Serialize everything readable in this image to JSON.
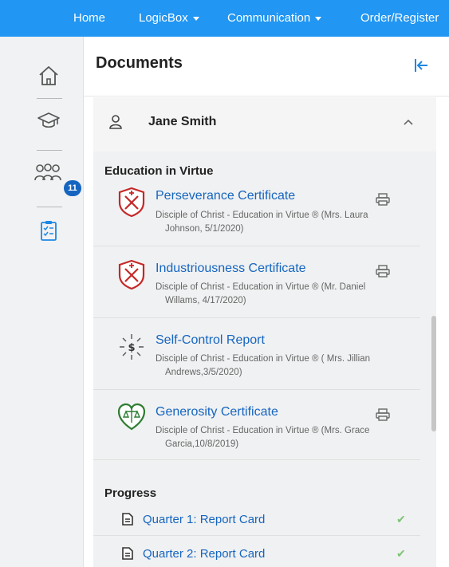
{
  "nav": {
    "items": [
      {
        "label": "Home",
        "has_caret": false
      },
      {
        "label": "LogicBox",
        "has_caret": true
      },
      {
        "label": "Communication",
        "has_caret": true
      },
      {
        "label": "Order/Register",
        "has_caret": false
      }
    ]
  },
  "sidebar": {
    "icons": [
      "home-icon",
      "graduation-cap-icon",
      "people-group-icon",
      "clipboard-checklist-icon"
    ],
    "people_badge": "11"
  },
  "header": {
    "title": "Documents",
    "collapse_icon": "collapse-left-icon"
  },
  "student": {
    "name": "Jane Smith",
    "expand_icon": "chevron-up-icon"
  },
  "education": {
    "section_title": "Education in Virtue",
    "documents": [
      {
        "title": "Perseverance Certificate",
        "meta_line1": "Disciple of Christ - Education in Virtue ® (Mrs. Laura",
        "meta_line2": "Johnson, 5/1/2020)",
        "icon": "shield-crossed-swords-icon",
        "printable": true
      },
      {
        "title": "Industriousness Certificate",
        "meta_line1": "Disciple of Christ - Education in Virtue ® (Mr. Daniel",
        "meta_line2": "Willams,  4/17/2020)",
        "icon": "shield-crossed-swords-icon",
        "printable": true
      },
      {
        "title": "Self-Control Report",
        "meta_line1": "Disciple of Christ - Education in Virtue ® ( Mrs. Jillian",
        "meta_line2": "Andrews,3/5/2020)",
        "icon": "radiant-dollar-icon",
        "printable": false
      },
      {
        "title": "Generosity Certificate",
        "meta_line1": "Disciple of Christ - Education in Virtue ® (Mrs. Grace",
        "meta_line2": "Garcia,10/8/2019)",
        "icon": "heart-scales-icon",
        "printable": true
      }
    ]
  },
  "progress": {
    "section_title": "Progress",
    "items": [
      {
        "label": "Quarter 1: Report Card",
        "status": "complete"
      },
      {
        "label": "Quarter 2: Report Card",
        "status": "complete"
      }
    ]
  },
  "colors": {
    "nav_bg": "#2196f3",
    "link": "#1565c0",
    "shield_red": "#c62828",
    "heart_green": "#2e7d32",
    "check_green": "#7cc576"
  }
}
